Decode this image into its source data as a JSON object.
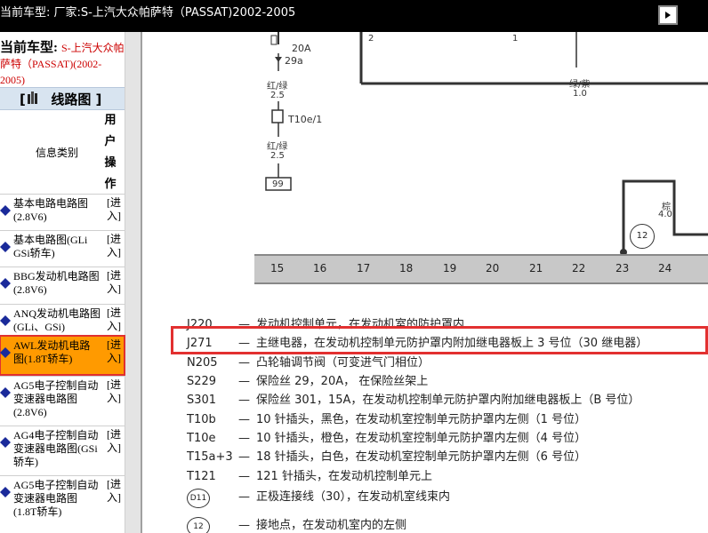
{
  "window": {
    "title": "当前车型:  厂家:S-上汽大众帕萨特（PASSAT)2002-2005"
  },
  "sidebar": {
    "current_label": "当前车型:",
    "current_value": "S-上汽大众帕萨特（PASSAT)(2002-2005)",
    "section_title": "线路图 ]",
    "section_bracket": "[",
    "col_info": "信息类别",
    "col_op": "用户操作",
    "items": [
      {
        "name": "基本电路电路图(2.8V6)",
        "enter": "[进入]"
      },
      {
        "name": "基本电路图(GLi GSi轿车)",
        "enter": "[进入]"
      },
      {
        "name": "BBG发动机电路图(2.8V6)",
        "enter": "[进入]"
      },
      {
        "name": "ANQ发动机电路图(GLi、GSi)",
        "enter": "[进入]"
      },
      {
        "name": "AWL发动机电路图(1.8T轿车)",
        "enter": "[进入]"
      },
      {
        "name": "AG5电子控制自动变速器电路图(2.8V6)",
        "enter": "[进入]"
      },
      {
        "name": "AG4电子控制自动变速器电路图(GSi轿车)",
        "enter": "[进入]"
      },
      {
        "name": "AG5电子控制自动变速器电路图(1.8T轿车)",
        "enter": "[进入]"
      }
    ]
  },
  "diagram": {
    "wire_labels": {
      "fuse_amp": "20A",
      "fuse_code": "29a",
      "wire1_color": "红/绿",
      "wire1_size": "2.5",
      "connector": "T10e/1",
      "wire2_color": "红/绿",
      "wire2_size": "2.5",
      "box_num": "99",
      "wire3_color": "绿/紫",
      "wire3_size": "1.0",
      "wire4_color": "棕",
      "wire4_size": "4.0",
      "ground_num": "12",
      "top_left_num": "2",
      "top_right_num": "1"
    },
    "ruler": [
      "15",
      "16",
      "17",
      "18",
      "19",
      "20",
      "21",
      "22",
      "23",
      "24"
    ],
    "legend": [
      {
        "code": "J220",
        "desc": "发动机控制单元，在发动机室的防护罩内"
      },
      {
        "code": "J271",
        "desc": "主继电器，在发动机控制单元防护罩内附加继电器板上 3 号位（30 继电器）"
      },
      {
        "code": "N205",
        "desc": "凸轮轴调节阀（可变进气门相位）"
      },
      {
        "code": "S229",
        "desc": "保险丝 29，20A， 在保险丝架上"
      },
      {
        "code": "S301",
        "desc": "保险丝 301，15A，在发动机控制单元防护罩内附加继电器板上（B 号位）"
      },
      {
        "code": "T10b",
        "desc": "10 针插头，黑色，在发动机室控制单元防护罩内左侧（1 号位）"
      },
      {
        "code": "T10e",
        "desc": "10 针插头，橙色，在发动机室控制单元防护罩内左侧（4 号位）"
      },
      {
        "code": "T15a+3",
        "desc": "18 针插头，白色，在发动机室控制单元防护罩内左侧（6 号位）"
      },
      {
        "code": "T121",
        "desc": "121 针插头，在发动机控制单元上"
      },
      {
        "code": "D11",
        "desc": "正极连接线（30），在发动机室线束内"
      },
      {
        "code": "12",
        "desc": "接地点，在发动机室内的左侧"
      }
    ]
  },
  "colors": {
    "topbar_bg": "#000000",
    "highlight": "#e23030",
    "active_item_bg": "#ff9a00",
    "current_car_value": "#cc0000"
  }
}
